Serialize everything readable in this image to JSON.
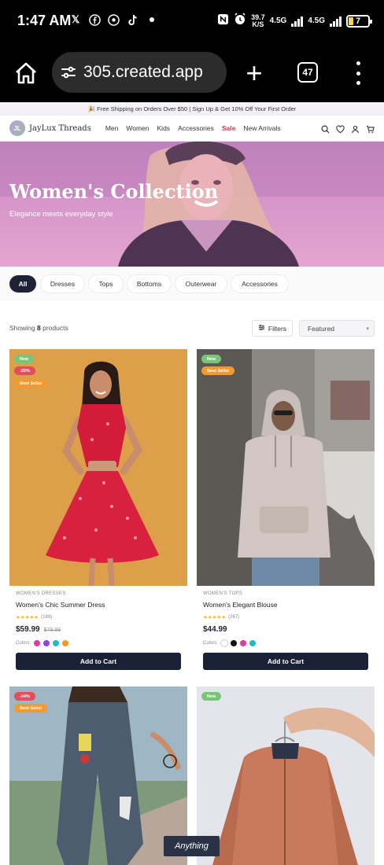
{
  "status_bar": {
    "time": "1:47 AM",
    "speed_value": "39.7",
    "speed_unit": "K/S",
    "net1": "4.5G",
    "net2": "4.5G",
    "battery": "7"
  },
  "browser": {
    "url": "305.created.app",
    "tab_count": "47"
  },
  "promo": {
    "text": "🎉 Free Shipping on Orders Over $50 | Sign Up & Get 10% Off Your First Order"
  },
  "header": {
    "logo_initials": "JL",
    "brand": "JayLux Threads",
    "nav": [
      "Men",
      "Women",
      "Kids",
      "Accessories",
      "Sale",
      "New Arrivals"
    ]
  },
  "hero": {
    "title": "Women's Collection",
    "subtitle": "Elegance meets everyday style"
  },
  "categories": [
    "All",
    "Dresses",
    "Tops",
    "Bottoms",
    "Outerwear",
    "Accessories"
  ],
  "toolbar": {
    "showing_prefix": "Showing",
    "count": "8",
    "showing_suffix": "products",
    "filters_label": "Filters",
    "sort_selected": "Featured"
  },
  "products": [
    {
      "category": "WOMEN'S DRESSES",
      "name": "Women's Chic Summer Dress",
      "rating": "★★★★★",
      "reviews": "(189)",
      "price": "$59.99",
      "old_price": "$79.99",
      "colors_label": "Colors:",
      "badges": [
        "New",
        "-25%",
        "Best Seller"
      ],
      "button": "Add to Cart"
    },
    {
      "category": "WOMEN'S TOPS",
      "name": "Women's Elegant Blouse",
      "rating": "★★★★★",
      "reviews": "(267)",
      "price": "$44.99",
      "old_price": "",
      "colors_label": "Colors:",
      "badges": [
        "New",
        "Best Seller"
      ],
      "button": "Add to Cart"
    },
    {
      "badges": [
        "-24%",
        "Best Seller"
      ]
    },
    {
      "badges": [
        "New"
      ]
    }
  ],
  "swatch_colors": {
    "p1": [
      "#e23b9b",
      "#8e44ec",
      "#22b9c9",
      "#f39a1f"
    ],
    "p2": [
      "#ffffff",
      "#111111",
      "#e23b9b",
      "#22b9c9"
    ]
  },
  "watermark": "Anything"
}
